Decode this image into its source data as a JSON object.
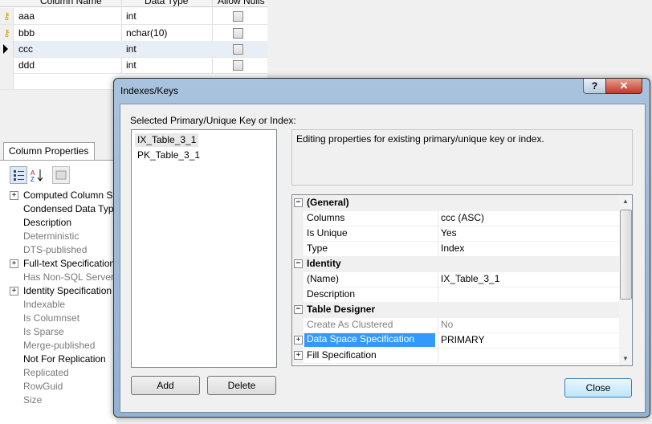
{
  "grid": {
    "headers": [
      "Column Name",
      "Data Type",
      "Allow Nulls"
    ],
    "rows": [
      {
        "name": "aaa",
        "type": "int"
      },
      {
        "name": "bbb",
        "type": "nchar(10)"
      },
      {
        "name": "ccc",
        "type": "int"
      },
      {
        "name": "ddd",
        "type": "int"
      }
    ]
  },
  "column_properties": {
    "tab": "Column Properties",
    "items": [
      {
        "label": "Computed Column Specification",
        "expand": "+"
      },
      {
        "label": "Condensed Data Type"
      },
      {
        "label": "Description"
      },
      {
        "label": "Deterministic"
      },
      {
        "label": "DTS-published"
      },
      {
        "label": "Full-text Specification",
        "expand": "+"
      },
      {
        "label": "Has Non-SQL Server Subscriber"
      },
      {
        "label": "Identity Specification",
        "expand": "+"
      },
      {
        "label": "Indexable"
      },
      {
        "label": "Is Columnset"
      },
      {
        "label": "Is Sparse"
      },
      {
        "label": "Merge-published"
      },
      {
        "label": "Not For Replication"
      },
      {
        "label": "Replicated"
      },
      {
        "label": "RowGuid"
      },
      {
        "label": "Size"
      }
    ]
  },
  "dialog": {
    "title": "Indexes/Keys",
    "help": "?",
    "close_glyph": "✕",
    "selected_label": "Selected Primary/Unique Key or Index:",
    "keys": [
      "IX_Table_3_1",
      "PK_Table_3_1"
    ],
    "description": "Editing properties for existing primary/unique key or index.",
    "add_label": "Add",
    "delete_label": "Delete",
    "close_label": "Close",
    "properties": [
      {
        "name": "(General)",
        "category": true,
        "expand": "−"
      },
      {
        "name": "Columns",
        "value": "ccc (ASC)"
      },
      {
        "name": "Is Unique",
        "value": "Yes"
      },
      {
        "name": "Type",
        "value": "Index"
      },
      {
        "name": "Identity",
        "category": true,
        "expand": "−"
      },
      {
        "name": "(Name)",
        "value": "IX_Table_3_1"
      },
      {
        "name": "Description",
        "value": ""
      },
      {
        "name": "Table Designer",
        "category": true,
        "expand": "−"
      },
      {
        "name": "Create As Clustered",
        "value": "No"
      },
      {
        "name": "Data Space Specification",
        "value": "PRIMARY",
        "expand": "+"
      },
      {
        "name": "Fill Specification",
        "value": "",
        "expand": "+"
      }
    ]
  },
  "colors": {
    "accent": "#3399ff",
    "title_bar": "#a9c3df",
    "close_red": "#c0392b"
  }
}
